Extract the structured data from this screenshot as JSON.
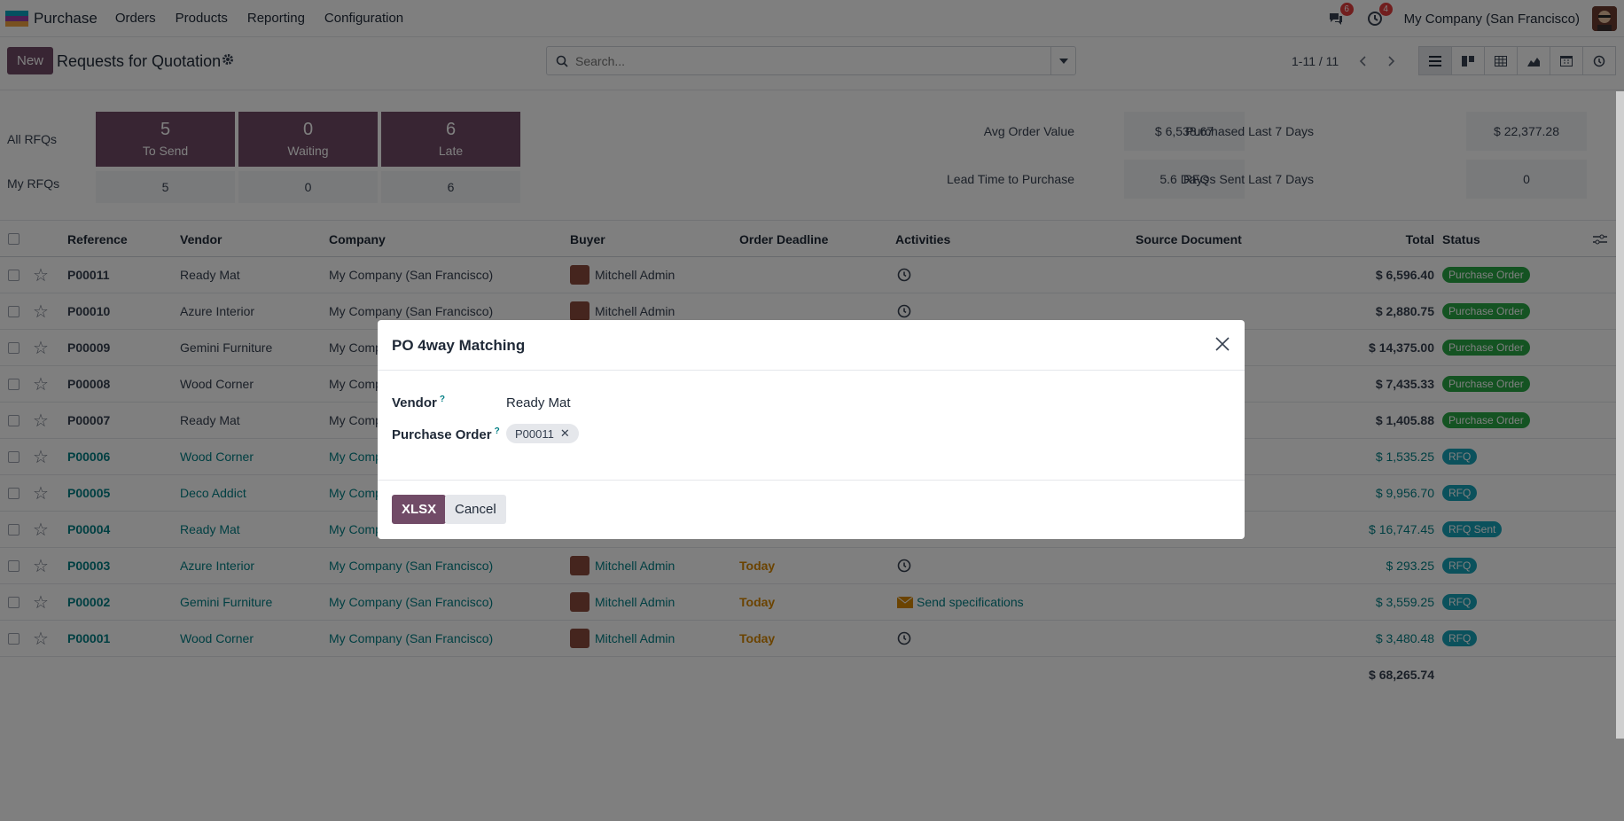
{
  "nav": {
    "app_name": "Purchase",
    "menu": [
      "Orders",
      "Products",
      "Reporting",
      "Configuration"
    ],
    "messages_count": "6",
    "activities_count": "4",
    "company": "My Company (San Francisco)",
    "icons": [
      "chat-icon",
      "clock-icon"
    ]
  },
  "control": {
    "new_label": "New",
    "title": "Requests for Quotation",
    "search_placeholder": "Search...",
    "pager": "1-11 / 11"
  },
  "dashboard": {
    "all_label": "All RFQs",
    "my_label": "My RFQs",
    "tiles": [
      {
        "num": "5",
        "label": "To Send",
        "my": "5"
      },
      {
        "num": "0",
        "label": "Waiting",
        "my": "0"
      },
      {
        "num": "6",
        "label": "Late",
        "my": "6"
      }
    ],
    "kpis": {
      "avg_order_label": "Avg Order Value",
      "avg_order_value": "$ 6,538.67",
      "purchased_label": "Purchased Last 7 Days",
      "purchased_value": "$ 22,377.28",
      "lead_label": "Lead Time to Purchase",
      "lead_value": "5.6 Days",
      "rfqs_sent_label": "RFQs Sent Last 7 Days",
      "rfqs_sent_value": "0"
    }
  },
  "table": {
    "headers": {
      "reference": "Reference",
      "vendor": "Vendor",
      "company": "Company",
      "buyer": "Buyer",
      "deadline": "Order Deadline",
      "activities": "Activities",
      "source": "Source Document",
      "total": "Total",
      "status": "Status"
    },
    "rows": [
      {
        "ref": "P00011",
        "vendor": "Ready Mat",
        "company": "My Company (San Francisco)",
        "buyer": "Mitchell Admin",
        "deadline": "",
        "activity": "",
        "total": "$ 6,596.40",
        "status": "Purchase Order"
      },
      {
        "ref": "P00010",
        "vendor": "Azure Interior",
        "company": "My Company (San Francisco)",
        "buyer": "Mitchell Admin",
        "deadline": "",
        "activity": "",
        "total": "$ 2,880.75",
        "status": "Purchase Order"
      },
      {
        "ref": "P00009",
        "vendor": "Gemini Furniture",
        "company": "My Comp",
        "buyer": "",
        "deadline": "",
        "activity": "",
        "total": "$ 14,375.00",
        "status": "Purchase Order"
      },
      {
        "ref": "P00008",
        "vendor": "Wood Corner",
        "company": "My Comp",
        "buyer": "",
        "deadline": "",
        "activity": "",
        "total": "$ 7,435.33",
        "status": "Purchase Order"
      },
      {
        "ref": "P00007",
        "vendor": "Ready Mat",
        "company": "My Comp",
        "buyer": "",
        "deadline": "",
        "activity": "",
        "total": "$ 1,405.88",
        "status": "Purchase Order"
      },
      {
        "ref": "P00006",
        "vendor": "Wood Corner",
        "company": "My Comp",
        "buyer": "",
        "deadline": "",
        "activity": "",
        "total": "$ 1,535.25",
        "status": "RFQ"
      },
      {
        "ref": "P00005",
        "vendor": "Deco Addict",
        "company": "My Comp",
        "buyer": "",
        "deadline": "",
        "activity": "",
        "total": "$ 9,956.70",
        "status": "RFQ"
      },
      {
        "ref": "P00004",
        "vendor": "Ready Mat",
        "company": "My Comp",
        "buyer": "",
        "deadline": "",
        "activity": "",
        "total": "$ 16,747.45",
        "status": "RFQ Sent"
      },
      {
        "ref": "P00003",
        "vendor": "Azure Interior",
        "company": "My Company (San Francisco)",
        "buyer": "Mitchell Admin",
        "deadline": "Today",
        "activity": "",
        "total": "$ 293.25",
        "status": "RFQ"
      },
      {
        "ref": "P00002",
        "vendor": "Gemini Furniture",
        "company": "My Company (San Francisco)",
        "buyer": "Mitchell Admin",
        "deadline": "Today",
        "activity": "Send specifications",
        "total": "$ 3,559.25",
        "status": "RFQ"
      },
      {
        "ref": "P00001",
        "vendor": "Wood Corner",
        "company": "My Company (San Francisco)",
        "buyer": "Mitchell Admin",
        "deadline": "Today",
        "activity": "",
        "total": "$ 3,480.48",
        "status": "RFQ"
      }
    ],
    "grand_total": "$ 68,265.74"
  },
  "modal": {
    "title": "PO 4way Matching",
    "vendor_label": "Vendor",
    "vendor_help": "?",
    "vendor_value": "Ready Mat",
    "po_label": "Purchase Order",
    "po_help": "?",
    "po_tag": "P00011",
    "xlsx_label": "XLSX",
    "cancel_label": "Cancel"
  },
  "colors": {
    "brand": "#714b67",
    "link": "#017e84",
    "po_badge": "#28a745",
    "rfq_badge": "#17a2b8",
    "today": "#d68600"
  }
}
